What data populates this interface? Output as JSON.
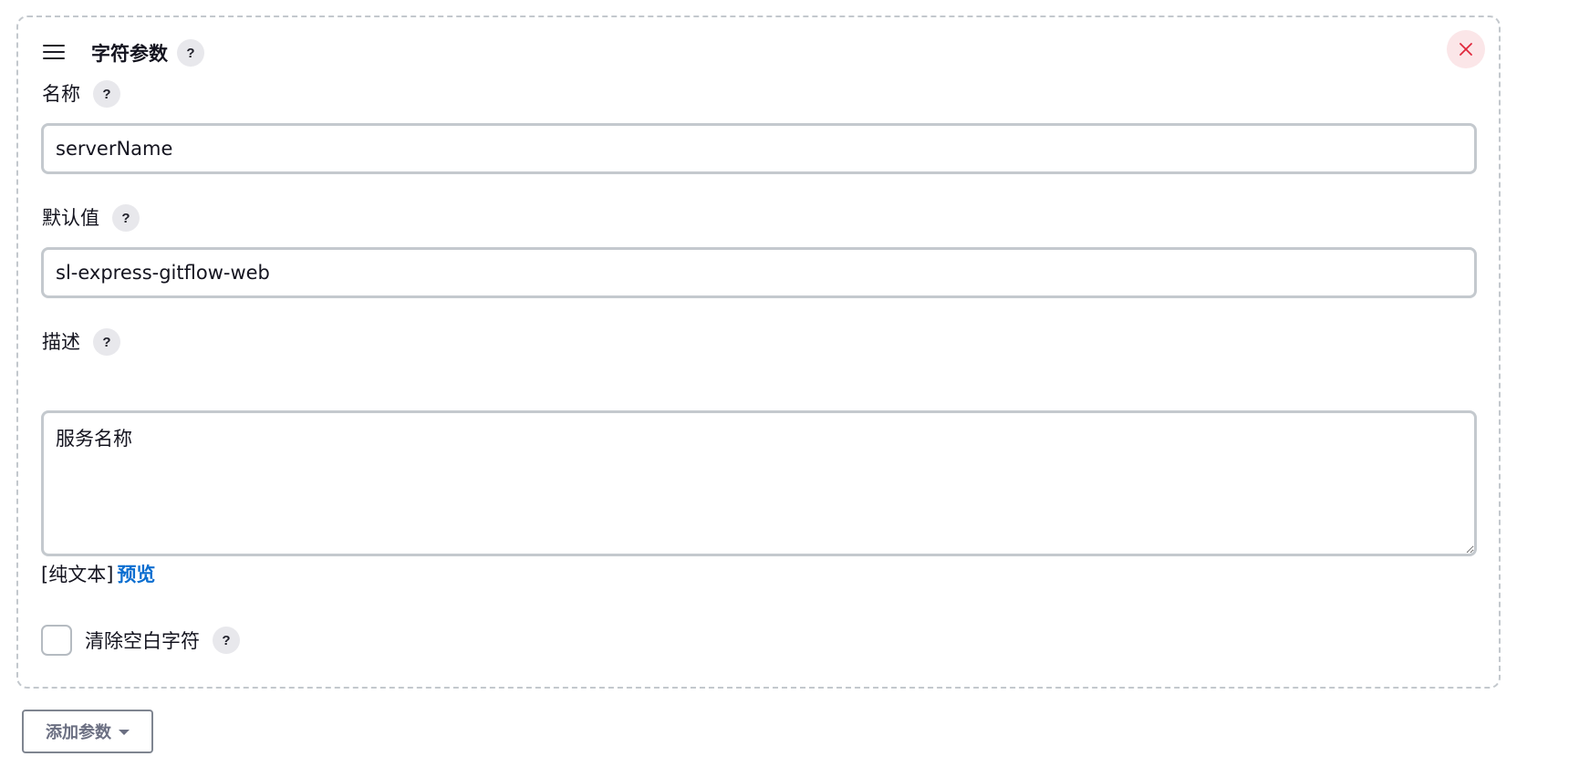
{
  "card": {
    "title": "字符参数",
    "help_icon": "?"
  },
  "fields": {
    "name": {
      "label": "名称",
      "help_icon": "?",
      "value": "serverName"
    },
    "default_value": {
      "label": "默认值",
      "help_icon": "?",
      "value": "sl-express-gitflow-web"
    },
    "description": {
      "label": "描述",
      "help_icon": "?",
      "value": "服务名称",
      "format_text": "[纯文本]",
      "preview_link": "预览"
    }
  },
  "trim": {
    "label": "清除空白字符",
    "help_icon": "?",
    "checked": false
  },
  "add_param_button": {
    "label": "添加参数"
  },
  "colors": {
    "close_icon": "#e0283c",
    "close_bg": "#fbe6e8",
    "link": "#0b6ed0",
    "border": "#c4c9ce"
  },
  "icons": {
    "drag_handle": "hamburger-icon",
    "close": "close-icon",
    "dropdown": "caret-down-icon"
  }
}
